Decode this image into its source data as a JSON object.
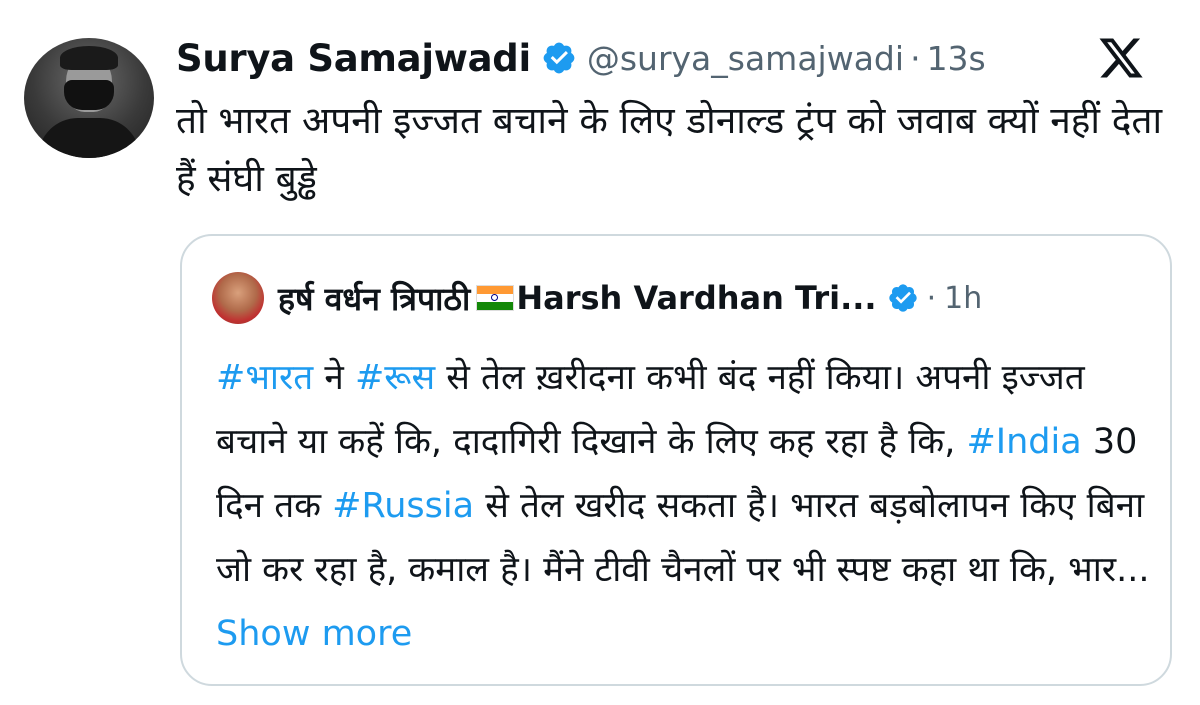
{
  "tweet": {
    "author_name": "Surya Samajwadi",
    "handle": "@surya_samajwadi",
    "separator": "·",
    "time": "13s",
    "text": "तो भारत अपनी इज्जत बचाने के लिए डोनाल्ड ट्रंप को जवाब क्यों नहीं देता हैं संघी बुड्ढे"
  },
  "quoted_tweet": {
    "author_name_hindi": "हर्ष वर्धन त्रिपाठी",
    "author_name_english": "Harsh Vardhan Tri...",
    "separator": "·",
    "time": "1h",
    "segments": {
      "tag_bharat": "#भारत",
      "t1": " ने ",
      "tag_roos": "#रूस",
      "t2": " से तेल ख़रीदना कभी बंद नहीं किया। अपनी इज्जत बचाने या कहें कि, दादागिरी दिखाने के लिए कह रहा है कि, ",
      "tag_india": "#India",
      "t3": " 30 दिन तक ",
      "tag_russia": "#Russia",
      "t4": " से तेल खरीद सकता है। भारत बड़बोलापन किए बिना जो कर रहा है, कमाल है। मैंने टीवी चैनलों पर भी स्पष्ट कहा था कि, भार... ",
      "show_more": "Show more"
    }
  },
  "colors": {
    "link": "#1d9bf0",
    "verified": "#1d9bf0",
    "secondary_text": "#536471",
    "border": "#cfd9de"
  },
  "icons": {
    "verified": "verified-badge-icon",
    "platform": "x-logo-icon",
    "flag": "india-flag-icon"
  }
}
